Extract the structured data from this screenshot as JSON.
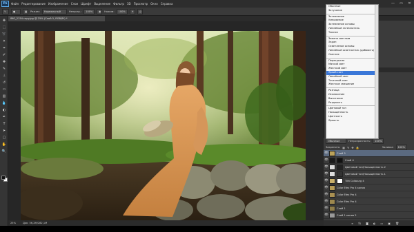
{
  "menubar": {
    "logo": "Ps",
    "items": [
      "Файл",
      "Редактирование",
      "Изображение",
      "Слои",
      "Шрифт",
      "Выделение",
      "Фильтр",
      "3D",
      "Просмотр",
      "Окно",
      "Справка"
    ],
    "window_controls": [
      "—",
      "▭",
      "✕"
    ]
  },
  "options": {
    "mode_label": "Режим:",
    "mode_value": "Нормальный",
    "opacity_label": "Непрозр.:",
    "opacity_value": "100%",
    "flow_label": "Нажим:",
    "flow_value": "100%"
  },
  "document": {
    "tab_title": "IMG_2154 copy.jpg @ 25% (Слой 5, RGB/8*) *",
    "zoom": "25%",
    "doc_info": "Док: 56,2M/282,1M"
  },
  "blend_dropdown": {
    "groups": [
      [
        "Обычные",
        "Затухание"
      ],
      [
        "Затемнение",
        "Умножение",
        "Затемнение основы",
        "Линейный затемнитель",
        "Темнее"
      ],
      [
        "Замена светлым",
        "Экран",
        "Осветление основы",
        "Линейный осветлитель (добавить)",
        "Светлее"
      ],
      [
        "Перекрытие",
        "Мягкий свет",
        "Жесткий свет",
        "Яркий свет",
        "Линейный свет",
        "Точечный свет",
        "Жесткое смешение"
      ],
      [
        "Разница",
        "Исключение",
        "Вычитание",
        "Разделить"
      ],
      [
        "Цветовой тон",
        "Насыщенность",
        "Цветность",
        "Яркость"
      ]
    ],
    "selected": "Яркий свет"
  },
  "layers": {
    "kind_label": "Вид",
    "blend_value": "Обычные",
    "opacity_label": "Непрозрачность:",
    "opacity_value": "100%",
    "lock_label": "Закрепить:",
    "fill_label": "Заливка:",
    "fill_value": "100%",
    "items": [
      {
        "name": "Слой 5"
      },
      {
        "name": "Слой 4"
      },
      {
        "name": "Цветовой тон/Насыщенность 2"
      },
      {
        "name": "Цветовой тон/Насыщенность 1"
      },
      {
        "name": "Tiltt Colbourg 4"
      },
      {
        "name": "Color Efex Pro 4 копия"
      },
      {
        "name": "Color Efex Pro 4"
      },
      {
        "name": "Color Efex Pro 4"
      },
      {
        "name": "Слой 1"
      },
      {
        "name": "Слой 1 копия 2"
      }
    ],
    "footer_icons": [
      "link-icon",
      "fx-icon",
      "mask-icon",
      "adjustment-icon",
      "folder-icon",
      "new-layer-icon",
      "trash-icon"
    ]
  },
  "colors": {
    "accent": "#e89a2b",
    "selection": "#3a77d8",
    "panel_bg": "#3b3b3b"
  }
}
